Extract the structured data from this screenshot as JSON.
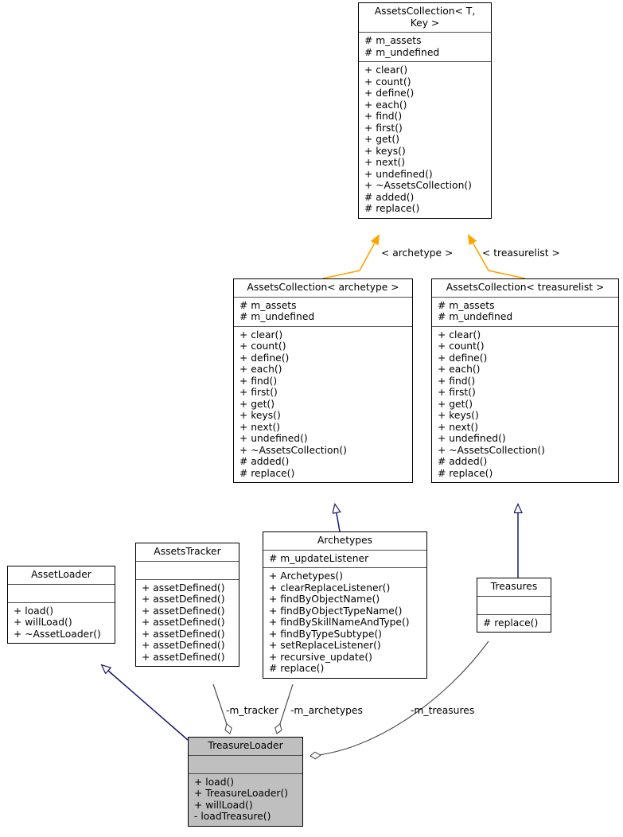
{
  "diagram": {
    "type": "uml-class-diagram",
    "colors": {
      "inheritance_arrow": "#191970",
      "template_binding_arrow": "#ffa500",
      "aggregation_line": "#4d4d4d",
      "class_border": "#000000",
      "highlight_fill": "#bfbfbf",
      "background": "#ffffff"
    },
    "classes": [
      {
        "id": "assetscollection-t-key",
        "name": "AssetsCollection< T,\nKey >",
        "attributes": [
          "# m_assets",
          "# m_undefined"
        ],
        "operations": [
          "+ clear()",
          "+ count()",
          "+ define()",
          "+ each()",
          "+ find()",
          "+ first()",
          "+ get()",
          "+ keys()",
          "+ next()",
          "+ undefined()",
          "+ ~AssetsCollection()",
          "# added()",
          "# replace()"
        ]
      },
      {
        "id": "assetscollection-archetype",
        "name": "AssetsCollection< archetype >",
        "attributes": [
          "# m_assets",
          "# m_undefined"
        ],
        "operations": [
          "+ clear()",
          "+ count()",
          "+ define()",
          "+ each()",
          "+ find()",
          "+ first()",
          "+ get()",
          "+ keys()",
          "+ next()",
          "+ undefined()",
          "+ ~AssetsCollection()",
          "# added()",
          "# replace()"
        ]
      },
      {
        "id": "assetscollection-treasurelist",
        "name": "AssetsCollection< treasurelist >",
        "attributes": [
          "# m_assets",
          "# m_undefined"
        ],
        "operations": [
          "+ clear()",
          "+ count()",
          "+ define()",
          "+ each()",
          "+ find()",
          "+ first()",
          "+ get()",
          "+ keys()",
          "+ next()",
          "+ undefined()",
          "+ ~AssetsCollection()",
          "# added()",
          "# replace()"
        ]
      },
      {
        "id": "assetloader",
        "name": "AssetLoader",
        "attributes": [],
        "operations": [
          "+ load()",
          "+ willLoad()",
          "+ ~AssetLoader()"
        ]
      },
      {
        "id": "assetstracker",
        "name": "AssetsTracker",
        "attributes": [],
        "operations": [
          "+ assetDefined()",
          "+ assetDefined()",
          "+ assetDefined()",
          "+ assetDefined()",
          "+ assetDefined()",
          "+ assetDefined()",
          "+ assetDefined()"
        ]
      },
      {
        "id": "archetypes",
        "name": "Archetypes",
        "attributes": [
          "# m_updateListener"
        ],
        "operations": [
          "+ Archetypes()",
          "+ clearReplaceListener()",
          "+ findByObjectName()",
          "+ findByObjectTypeName()",
          "+ findBySkillNameAndType()",
          "+ findByTypeSubtype()",
          "+ setReplaceListener()",
          "+ recursive_update()",
          "# replace()"
        ]
      },
      {
        "id": "treasures",
        "name": "Treasures",
        "attributes": [],
        "operations": [
          "# replace()"
        ]
      },
      {
        "id": "treasureloader",
        "name": "TreasureLoader",
        "attributes": [],
        "operations": [
          "+ load()",
          "+ TreasureLoader()",
          "+ willLoad()",
          "- loadTreasure()"
        ]
      }
    ],
    "edge_labels": [
      {
        "id": "label-archetype",
        "text": "< archetype >"
      },
      {
        "id": "label-treasurelist",
        "text": "< treasurelist >"
      },
      {
        "id": "label-m-tracker",
        "text": "-m_tracker"
      },
      {
        "id": "label-m-archetypes",
        "text": "-m_archetypes"
      },
      {
        "id": "label-m-treasures",
        "text": "-m_treasures"
      }
    ]
  }
}
